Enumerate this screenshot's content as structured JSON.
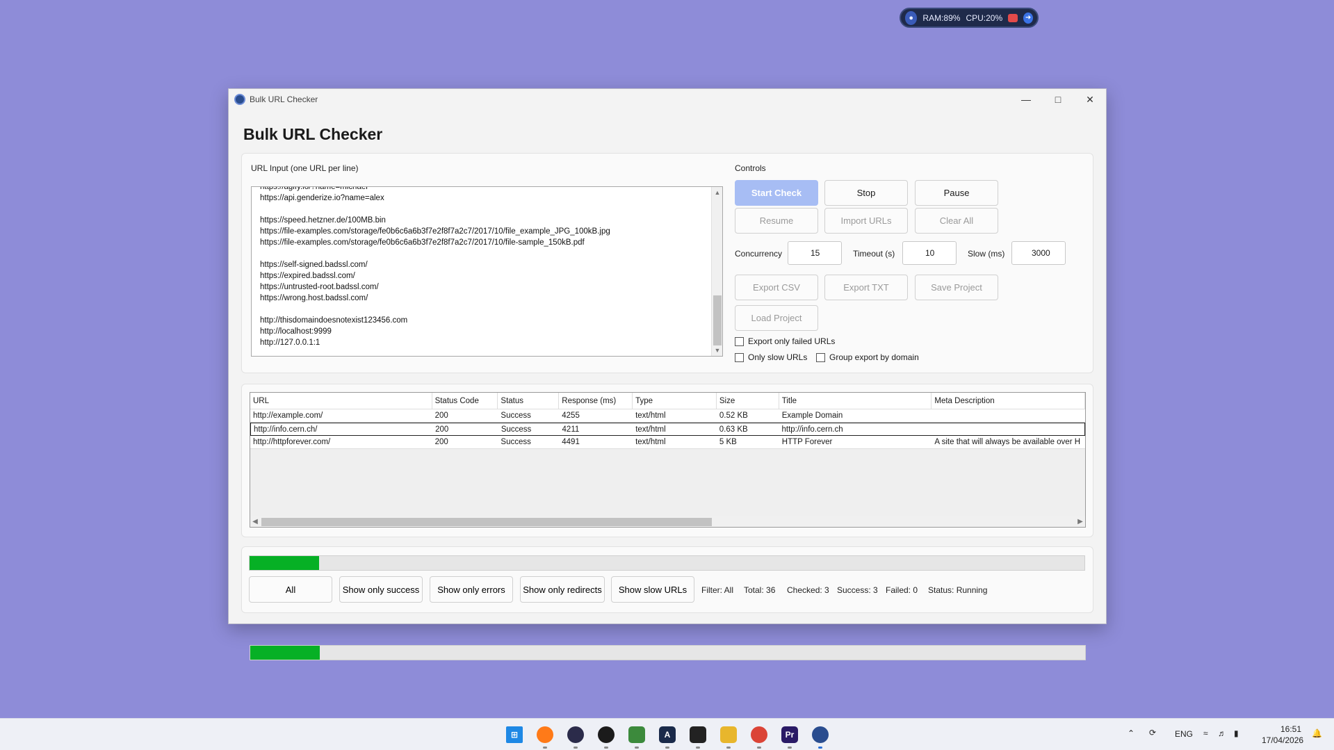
{
  "overlay": {
    "ram": "RAM:89%",
    "cpu": "CPU:20%"
  },
  "window": {
    "titlebar_title": "Bulk URL Checker",
    "page_title": "Bulk URL Checker"
  },
  "input": {
    "label": "URL Input (one URL per line)",
    "lines": [
      "https://agify.io/?name=michael",
      "https://api.genderize.io?name=alex",
      "",
      "https://speed.hetzner.de/100MB.bin",
      "https://file-examples.com/storage/fe0b6c6a6b3f7e2f8f7a2c7/2017/10/file_example_JPG_100kB.jpg",
      "https://file-examples.com/storage/fe0b6c6a6b3f7e2f8f7a2c7/2017/10/file-sample_150kB.pdf",
      "",
      "https://self-signed.badssl.com/",
      "https://expired.badssl.com/",
      "https://untrusted-root.badssl.com/",
      "https://wrong.host.badssl.com/",
      "",
      "http://thisdomaindoesnotexist123456.com",
      "http://localhost:9999",
      "http://127.0.0.1:1"
    ]
  },
  "controls": {
    "label": "Controls",
    "start": "Start Check",
    "stop": "Stop",
    "pause": "Pause",
    "resume": "Resume",
    "import": "Import URLs",
    "clear": "Clear All",
    "concurrency_label": "Concurrency",
    "concurrency_value": "15",
    "timeout_label": "Timeout (s)",
    "timeout_value": "10",
    "slow_label": "Slow (ms)",
    "slow_value": "3000",
    "export_csv": "Export CSV",
    "export_txt": "Export TXT",
    "save_project": "Save Project",
    "load_project": "Load Project",
    "chk_failed": "Export only failed URLs",
    "chk_slow": "Only slow URLs",
    "chk_group": "Group export by domain"
  },
  "table": {
    "headers": [
      "URL",
      "Status Code",
      "Status",
      "Response (ms)",
      "Type",
      "Size",
      "Title",
      "Meta Description"
    ],
    "rows": [
      [
        "http://example.com/",
        "200",
        "Success",
        "4255",
        "text/html",
        "0.52 KB",
        "Example Domain",
        ""
      ],
      [
        "http://info.cern.ch/",
        "200",
        "Success",
        "4211",
        "text/html",
        "0.63 KB",
        "http://info.cern.ch",
        ""
      ],
      [
        "http://httpforever.com/",
        "200",
        "Success",
        "4491",
        "text/html",
        "5 KB",
        "HTTP Forever",
        "A site that will always be available over H"
      ]
    ]
  },
  "progress": {
    "fraction": 0.083
  },
  "filters": {
    "all": "All",
    "success": "Show only success",
    "errors": "Show only errors",
    "redirects": "Show only redirects",
    "slow": "Show slow URLs"
  },
  "stats": {
    "filter": "Filter: All",
    "total": "Total: 36",
    "checked": "Checked: 3",
    "success": "Success: 3",
    "failed": "Failed: 0",
    "status": "Status: Running"
  },
  "tray": {
    "lang": "ENG",
    "time": "16:51",
    "date": "17/04/2026"
  },
  "colors": {
    "desktop": "#8e8cd8",
    "primary_button": "#a7bdf4",
    "progress_fill": "#06b025"
  }
}
